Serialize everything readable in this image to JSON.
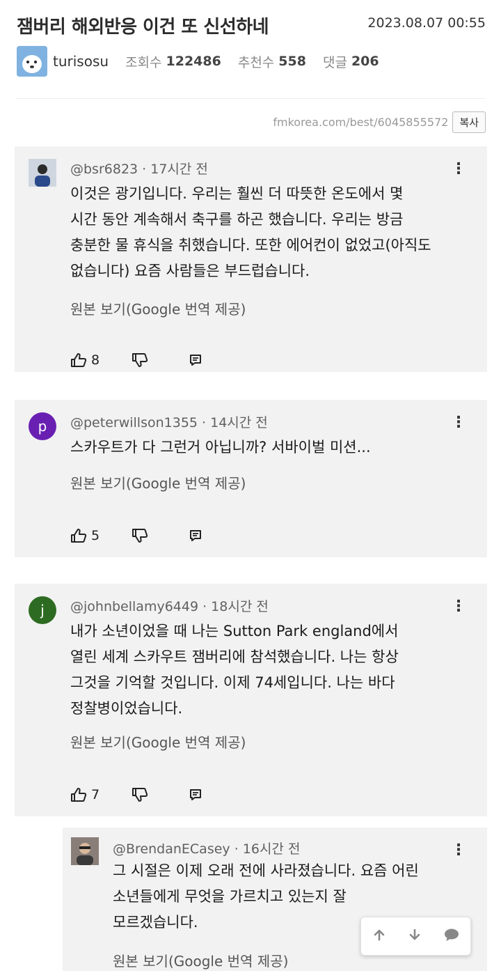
{
  "post": {
    "title": "잼버리 해외반응 이건 또 신선하네",
    "date": "2023.08.07 00:55",
    "author": "turisosu",
    "views_label": "조회수",
    "views": "122486",
    "recommend_label": "추천수",
    "recommend": "558",
    "comments_label": "댓글",
    "comments": "206",
    "url": "fmkorea.com/best/6045855572",
    "copy_label": "복사"
  },
  "comments": [
    {
      "handle": "@bsr6823 · 17시간 전",
      "lines": [
        "이것은 광기입니다. 우리는 훨씬 더 따뜻한 온도에서 몇",
        "시간 동안 계속해서 축구를 하곤 했습니다. 우리는 방금",
        "충분한 물 휴식을 취했습니다. 또한 에어컨이 없었고(아직도",
        "없습니다) 요즘 사람들은 부드럽습니다."
      ],
      "translate": "원본 보기(Google 번역 제공)",
      "likes": "8",
      "avatar_color": "#3b4a66"
    },
    {
      "handle": "@peterwillson1355 · 14시간 전",
      "lines": [
        "스카우트가 다 그런거 아닙니까? 서바이벌 미션..."
      ],
      "translate": "원본 보기(Google 번역 제공)",
      "likes": "5",
      "avatar_letter": "p",
      "avatar_color": "#6a1fb3"
    },
    {
      "handle": "@johnbellamy6449 · 18시간 전",
      "lines": [
        "내가 소년이었을 때 나는 Sutton Park england에서",
        "열린 세계 스카우트 잼버리에 참석했습니다. 나는 항상",
        "그것을 기억할 것입니다. 이제 74세입니다. 나는 바다",
        "정찰병이었습니다."
      ],
      "translate": "원본 보기(Google 번역 제공)",
      "likes": "7",
      "avatar_letter": "j",
      "avatar_color": "#2e6b22"
    },
    {
      "handle": "@BrendanECasey · 16시간 전",
      "lines": [
        "그 시절은 이제 오래 전에 사라졌습니다. 요즘 어린",
        "소년들에게 무엇을 가르치고 있는지 잘",
        "모르겠습니다."
      ],
      "translate": "원본 보기(Google 번역 제공)",
      "avatar_color": "#4a4a4a"
    }
  ]
}
